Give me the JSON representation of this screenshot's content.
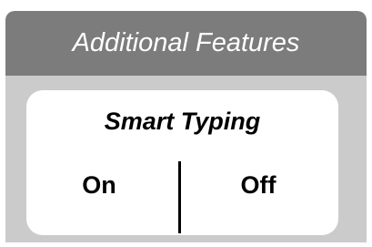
{
  "panel": {
    "title": "Additional Features"
  },
  "card": {
    "title": "Smart Typing",
    "options": [
      {
        "label": "On"
      },
      {
        "label": "Off"
      }
    ]
  },
  "colors": {
    "header_background": "#7c7c7c",
    "panel_background": "#cbcbcb",
    "card_background": "#ffffff",
    "title_text": "#ffffff",
    "body_text": "#000000"
  }
}
